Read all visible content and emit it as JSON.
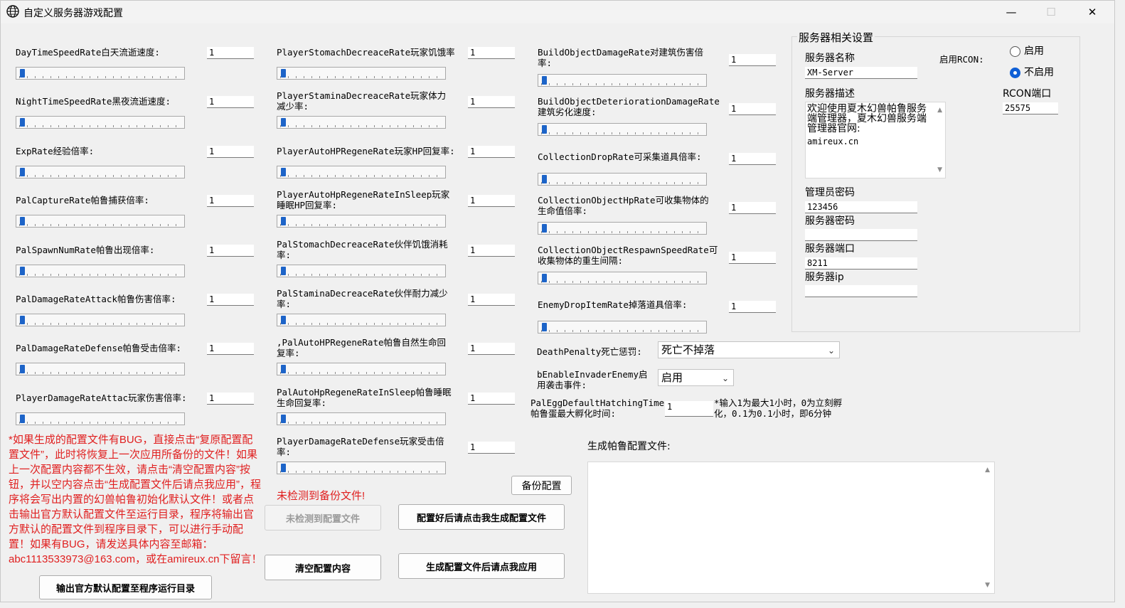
{
  "window": {
    "title": "自定义服务器游戏配置",
    "minimize": "—",
    "maximize": "☐",
    "close": "✕"
  },
  "col1": [
    {
      "label": "DayTimeSpeedRate白天流逝速度:",
      "value": "1"
    },
    {
      "label": "NightTimeSpeedRate黑夜流逝速度:",
      "value": "1"
    },
    {
      "label": "ExpRate经验倍率:",
      "value": "1"
    },
    {
      "label": "PalCaptureRate帕鲁捕获倍率:",
      "value": "1"
    },
    {
      "label": "PalSpawnNumRate帕鲁出现倍率:",
      "value": "1"
    },
    {
      "label": "PalDamageRateAttack帕鲁伤害倍率:",
      "value": "1"
    },
    {
      "label": "PalDamageRateDefense帕鲁受击倍率:",
      "value": "1"
    },
    {
      "label": "PlayerDamageRateAttac玩家伤害倍率:",
      "value": "1"
    }
  ],
  "col2": [
    {
      "label": "PlayerStomachDecreaceRate玩家饥饿率",
      "value": "1"
    },
    {
      "label": "PlayerStaminaDecreaceRate玩家体力\n减少率:",
      "value": "1"
    },
    {
      "label": "PlayerAutoHPRegeneRate玩家HP回复率:",
      "value": "1"
    },
    {
      "label": "PlayerAutoHpRegeneRateInSleep玩家\n睡眠HP回复率:",
      "value": "1"
    },
    {
      "label": "PalStomachDecreaceRate伙伴饥饿消耗\n率:",
      "value": "1"
    },
    {
      "label": "PalStaminaDecreaceRate伙伴耐力减少\n率:",
      "value": "1"
    },
    {
      "label": ",PalAutoHPRegeneRate帕鲁自然生命回\n复率:",
      "value": "1"
    },
    {
      "label": "PalAutoHpRegeneRateInSleep帕鲁睡眠\n生命回复率:",
      "value": "1"
    },
    {
      "label": "PlayerDamageRateDefense玩家受击倍\n率:",
      "value": "1"
    }
  ],
  "col3": [
    {
      "label": "BuildObjectDamageRate对建筑伤害倍\n率:",
      "value": "1"
    },
    {
      "label": "BuildObjectDeteriorationDamageRate\n建筑劣化速度:",
      "value": "1"
    },
    {
      "label": "CollectionDropRate可采集道具倍率:",
      "value": "1"
    },
    {
      "label": "CollectionObjectHpRate可收集物体的\n生命值倍率:",
      "value": "1"
    },
    {
      "label": "CollectionObjectRespawnSpeedRate可\n收集物体的重生间隔:",
      "value": "1"
    },
    {
      "label": "EnemyDropItemRate掉落道具倍率:",
      "value": "1"
    }
  ],
  "death_penalty": {
    "label": "DeathPenalty死亡惩罚:",
    "value": "死亡不掉落"
  },
  "invader": {
    "label": "bEnableInvaderEnemy启\n用袭击事件:",
    "value": "启用"
  },
  "egg": {
    "label": "PalEggDefaultHatchingTime\n帕鲁蛋最大孵化时间:",
    "value": "1",
    "hint": "*输入1为最大1小时，0为立刻孵\n化，0.1为0.1小时，即6分钟"
  },
  "server": {
    "group_title": "服务器相关设置",
    "name_label": "服务器名称",
    "name_value": "XM-Server",
    "rcon_label": "启用RCON:",
    "rcon_enable": "启用",
    "rcon_disable": "不启用",
    "desc_label": "服务器描述",
    "desc_value": "欢迎使用夏木幻兽帕鲁服务端管理器，夏木幻兽服务端管理器官网:",
    "desc_url": "amireux.cn",
    "rcon_port_label": "RCON端口",
    "rcon_port_value": "25575",
    "admin_pwd_label": "管理员密码",
    "admin_pwd_value": "123456",
    "server_pwd_label": "服务器密码",
    "server_pwd_value": "",
    "port_label": "服务器端口",
    "port_value": "8211",
    "ip_label": "服务器ip",
    "ip_value": ""
  },
  "notice": "*如果生成的配置文件有BUG，直接点击“复原配置配置文件”，此时将恢复上一次应用所备份的文件！如果上一次配置内容都不生效，请点击“清空配置内容”按钮，并以空内容点击“生成配置文件后请点我应用”，程序将会写出内置的幻兽帕鲁初始化默认文件！或者点击输出官方默认配置文件至运行目录，程序将输出官方默认的配置文件到程序目录下，可以进行手动配置！如果有BUG，请发送具体内容至邮箱：abc1113533973@163.com，或在amireux.cn下留言！",
  "backup_status": "未检测到备份文件!",
  "buttons": {
    "export_default": "输出官方默认配置至程序运行目录",
    "restore": "未检测到配置文件",
    "clear": "清空配置内容",
    "backup": "备份配置",
    "generate": "配置好后请点击我生成配置文件",
    "apply": "生成配置文件后请点我应用"
  },
  "output": {
    "label": "生成帕鲁配置文件:",
    "value": ""
  },
  "colors": {
    "accent": "#1d64c8",
    "warning": "#e02020"
  }
}
